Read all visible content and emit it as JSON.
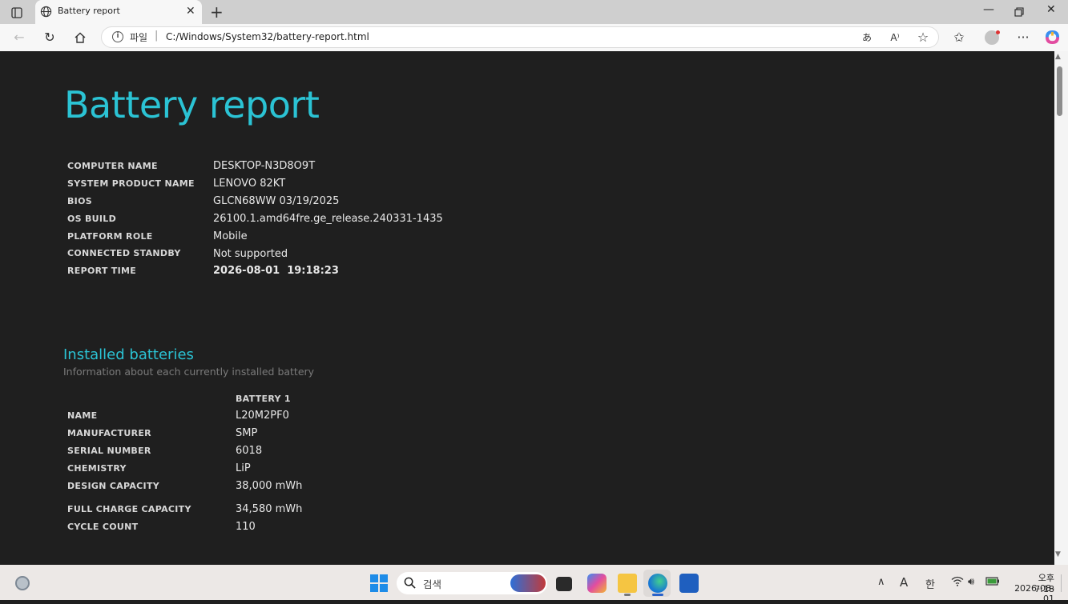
{
  "browser": {
    "tab_title": "Battery report",
    "address_scheme": "파일",
    "address_separator": "|",
    "address_url": "C:/Windows/System32/battery-report.html"
  },
  "report": {
    "title": "Battery report",
    "system_info": [
      {
        "label": "COMPUTER NAME",
        "value": "DESKTOP-N3D8O9T"
      },
      {
        "label": "SYSTEM PRODUCT NAME",
        "value": "LENOVO 82KT"
      },
      {
        "label": "BIOS",
        "value": "GLCN68WW 03/19/2025"
      },
      {
        "label": "OS BUILD",
        "value": "26100.1.amd64fre.ge_release.240331-1435"
      },
      {
        "label": "PLATFORM ROLE",
        "value": "Mobile"
      },
      {
        "label": "CONNECTED STANDBY",
        "value": "Not supported"
      },
      {
        "label": "REPORT TIME",
        "value": "2026-08-01  19:18:23"
      }
    ],
    "installed_batteries": {
      "title": "Installed batteries",
      "subtitle": "Information about each currently installed battery",
      "column_header": "BATTERY 1",
      "rows": [
        {
          "label": "NAME",
          "value": "L20M2PF0"
        },
        {
          "label": "MANUFACTURER",
          "value": "SMP"
        },
        {
          "label": "SERIAL NUMBER",
          "value": "6018"
        },
        {
          "label": "CHEMISTRY",
          "value": "LiP"
        },
        {
          "label": "DESIGN CAPACITY",
          "value": "38,000 mWh"
        },
        {
          "label": "FULL CHARGE CAPACITY",
          "value": "34,580 mWh"
        },
        {
          "label": "CYCLE COUNT",
          "value": "110"
        }
      ]
    }
  },
  "taskbar": {
    "search_placeholder": "검색",
    "time": "오후 7:18",
    "date": "2026-08-01",
    "ime_mode": "A",
    "ime_language": "한"
  },
  "colors": {
    "accent": "#2bc3d4",
    "content_bg": "#1f1f1f"
  }
}
